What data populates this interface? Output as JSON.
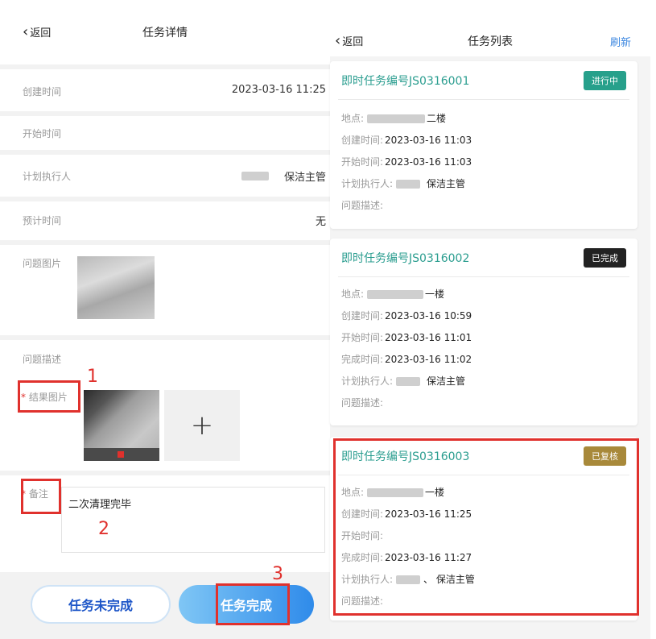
{
  "detail": {
    "back_label": "返回",
    "title": "任务详情",
    "rows": {
      "created_label": "创建时间",
      "created_value": "2023-03-16 11:25",
      "start_label": "开始时间",
      "executor_label": "计划执行人",
      "executor_value": "保洁主管",
      "estimate_label": "预计时间",
      "estimate_value": "无",
      "problem_image_label": "问题图片",
      "problem_desc_label": "问题描述",
      "result_image_label": "结果图片",
      "remark_label": "备注",
      "remark_value": "二次清理完毕"
    },
    "add_symbol": "+",
    "annotations": {
      "one": "1",
      "two": "2",
      "three": "3"
    },
    "buttons": {
      "undone": "任务未完成",
      "done": "任务完成"
    }
  },
  "list": {
    "back_label": "返回",
    "title": "任务列表",
    "refresh": "刷新",
    "labels": {
      "location": "地点:",
      "created": "创建时间:",
      "started": "开始时间:",
      "finished": "完成时间:",
      "executor": "计划执行人:",
      "desc": "问题描述:"
    },
    "cards": [
      {
        "code": "即时任务编号JS0316001",
        "status": "进行中",
        "status_color": "#27a08b",
        "location": "二楼",
        "created": "2023-03-16 11:03",
        "started": "2023-03-16 11:03",
        "executor": "保洁主管"
      },
      {
        "code": "即时任务编号JS0316002",
        "status": "已完成",
        "status_color": "#222222",
        "location": "一楼",
        "created": "2023-03-16 10:59",
        "started": "2023-03-16 11:01",
        "finished": "2023-03-16 11:02",
        "executor": "保洁主管"
      },
      {
        "code": "即时任务编号JS0316003",
        "status": "已复核",
        "status_color": "#a8893a",
        "location": "一楼",
        "created": "2023-03-16 11:25",
        "started": "",
        "finished": "2023-03-16 11:27",
        "executor": "、 保洁主管"
      }
    ]
  },
  "colors": {
    "accent_red": "#e0312d",
    "teal_code": "#2a9d8f",
    "blue_button": "#2f8bea"
  },
  "icons": {
    "back": "chevron-left-icon",
    "add": "plus-icon"
  }
}
